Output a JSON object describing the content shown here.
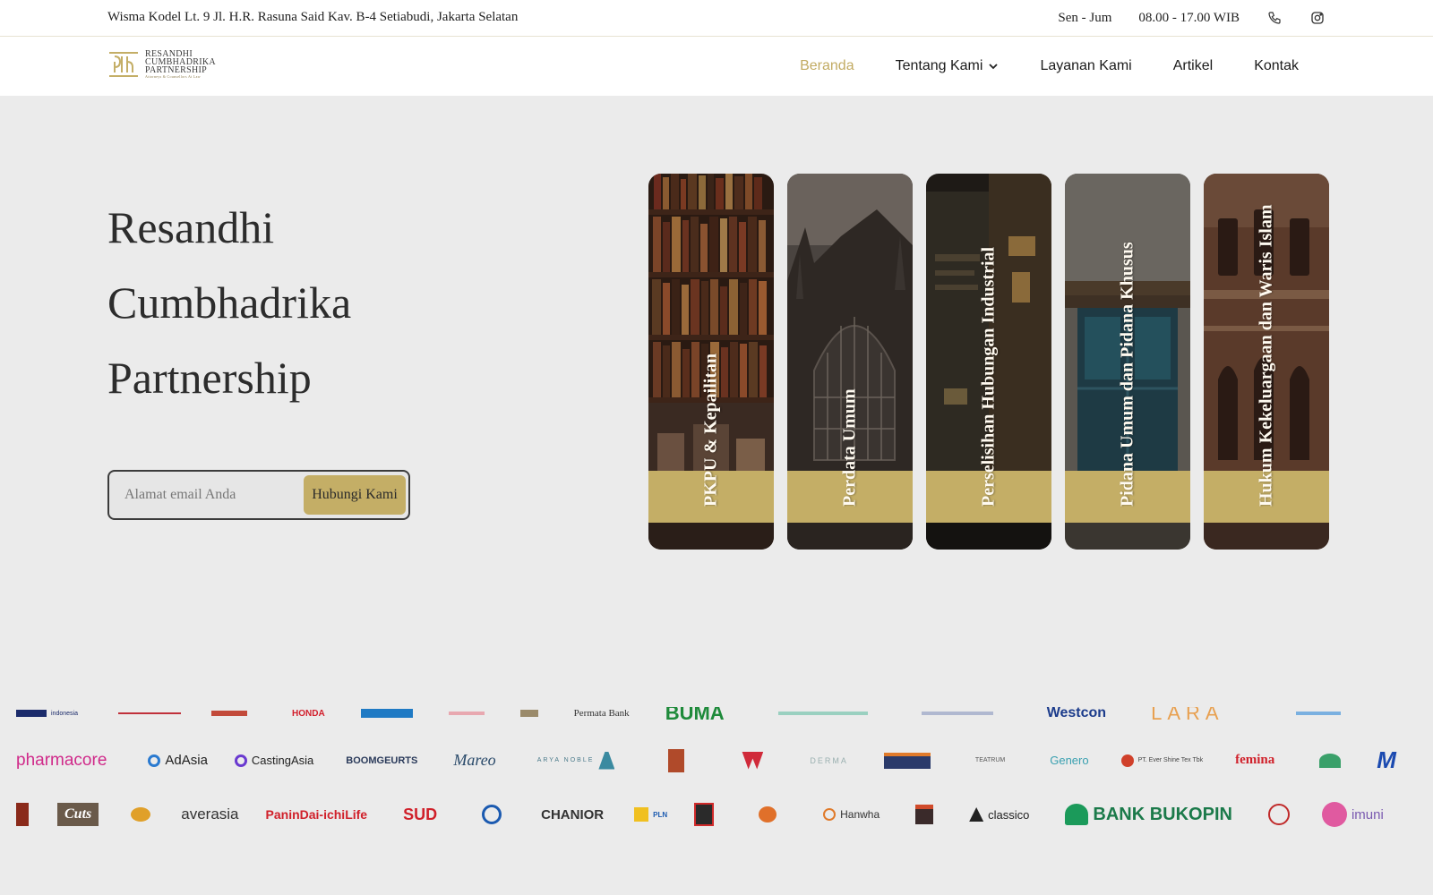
{
  "topbar": {
    "address": "Wisma Kodel Lt. 9 Jl. H.R. Rasuna Said Kav. B-4 Setiabudi, Jakarta Selatan",
    "days": "Sen - Jum",
    "hours": "08.00 - 17.00 WIB"
  },
  "logo": {
    "line1": "RESANDHI",
    "line2": "CUMBHADRIKA",
    "line3": "PARTNERSHIP",
    "tagline": "Attorneys & Counsellors At Law"
  },
  "nav": {
    "items": [
      {
        "label": "Beranda",
        "active": true
      },
      {
        "label": "Tentang Kami",
        "dropdown": true
      },
      {
        "label": "Layanan Kami"
      },
      {
        "label": "Artikel"
      },
      {
        "label": "Kontak"
      }
    ]
  },
  "hero": {
    "title_lines": [
      "Resandhi",
      "Cumbhadrika",
      "Partnership"
    ],
    "email_placeholder": "Alamat email Anda",
    "cta_label": "Hubungi Kami"
  },
  "services": [
    {
      "label": "PKPU & Kepailitan",
      "photo": "bookshelf"
    },
    {
      "label": "Perdata Umum",
      "photo": "gothic-church"
    },
    {
      "label": "Perselisihan Hubungan Industrial",
      "photo": "old-books"
    },
    {
      "label": "Pidana Umum dan Pidana Khusus",
      "photo": "old-door"
    },
    {
      "label": "Hukum Kekeluargaan dan Waris Islam",
      "photo": "old-building"
    }
  ],
  "clients": {
    "row1": [
      "indonesia",
      "",
      "",
      "HONDA",
      "",
      "",
      "",
      "Permata Bank",
      "BUMA",
      "",
      "",
      "",
      "Westcon",
      "LARA",
      ""
    ],
    "row2": [
      "pharmacore",
      "AdAsia",
      "CastingAsia",
      "BOOMGEURTS",
      "Mareo",
      "ARYA NOBLE",
      "",
      "",
      "DERMA",
      "",
      "TEATRUM",
      "Genero",
      "PT. Ever Shine Tex Tbk",
      "femina",
      "",
      "M"
    ],
    "row3": [
      "",
      "Cuts",
      "",
      "averasia",
      "PaninDai-ichiLife",
      "SUD",
      "",
      "CHANIOR",
      "PLN",
      "",
      "",
      "Hanwha",
      "",
      "classico",
      "BANK BUKOPIN",
      "",
      "imuni"
    ]
  },
  "colors": {
    "accent": "#c4ae66",
    "background": "#ebebeb",
    "text": "#2c2c2c"
  }
}
